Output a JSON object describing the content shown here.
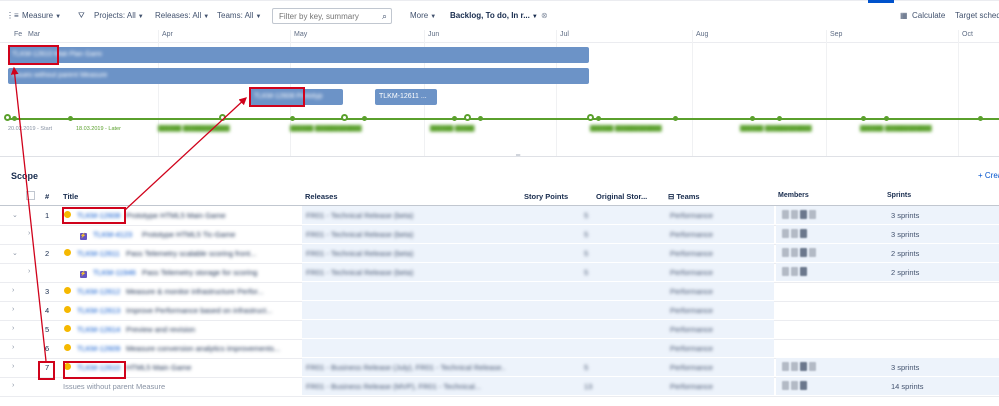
{
  "toolbar": {
    "measure": "Measure",
    "projects": "Projects: All",
    "releases": "Releases: All",
    "teams": "Teams: All",
    "search_placeholder": "Filter by key, summary",
    "more": "More",
    "view_filter": "Backlog, To do, In r...",
    "calculate": "Calculate",
    "target_schedule": "Target sched"
  },
  "months": [
    "Fe",
    "Mar",
    "Apr",
    "May",
    "Jun",
    "Jul",
    "Aug",
    "Sep",
    "Oct"
  ],
  "timeline": {
    "bar1_key": "TLKM-12610",
    "bar1_text": "TLKM-12610  Mali Plan Gami",
    "bar2_text": "Issues without parent Measure",
    "bar3_text": "TLKM-12608 Prototyp",
    "bar4_text": "TLKM-12611 ...",
    "release_start": "20.02.2019 - Start",
    "release_later": "18.03.2019 - Later"
  },
  "scope": {
    "title": "Scope",
    "create": "+ Crea"
  },
  "columns": {
    "num": "#",
    "title": "Title",
    "releases": "Releases",
    "story_points": "Story Points",
    "original": "Original Stor...",
    "teams": "Teams",
    "members": "Members",
    "sprints": "Sprints"
  },
  "rows": [
    {
      "num": "1",
      "key": "TLKM-12608",
      "summary": "Prototype HTML5 Main Game",
      "release": "FR01 - Technical Release (beta)",
      "points": "5",
      "team": "Performance",
      "sprints": "3 sprints"
    },
    {
      "num": "",
      "key": "TLKM-4123",
      "summary": "Prototype HTML5 Tic-Game",
      "release": "FR01 - Technical Release (beta)",
      "points": "5",
      "team": "Performance",
      "sprints": "3 sprints"
    },
    {
      "num": "2",
      "key": "TLKM-12611",
      "summary": "Pass Telemetry scalable scoring front...",
      "release": "FR01 - Technical Release (beta)",
      "points": "5",
      "team": "Performance",
      "sprints": "2 sprints"
    },
    {
      "num": "",
      "key": "TLKM-11946",
      "summary": "Pass Telemetry storage for scoring",
      "release": "FR01 - Technical Release (beta)",
      "points": "5",
      "team": "Performance",
      "sprints": "2 sprints"
    },
    {
      "num": "3",
      "key": "TLKM-12612",
      "summary": "Measure & monitor infrastructure Perfor...",
      "release": "",
      "points": "",
      "team": "Performance",
      "sprints": ""
    },
    {
      "num": "4",
      "key": "TLKM-12613",
      "summary": "Improve Performance based on infrastruct...",
      "release": "",
      "points": "",
      "team": "Performance",
      "sprints": ""
    },
    {
      "num": "5",
      "key": "TLKM-12614",
      "summary": "Preview and revision",
      "release": "",
      "points": "",
      "team": "Performance",
      "sprints": ""
    },
    {
      "num": "6",
      "key": "TLKM-12609",
      "summary": "Measure conversion analytics improvements...",
      "release": "",
      "points": "",
      "team": "Performance",
      "sprints": ""
    },
    {
      "num": "7",
      "key": "TLKM-12610",
      "summary": "HTML5 Main Game",
      "release": "FR01 - Business Release (July), FR01 - Technical Release...",
      "points": "5",
      "team": "Performance",
      "sprints": "3 sprints"
    },
    {
      "num": "",
      "key": "",
      "summary": "Issues without parent Measure",
      "release": "FR01 - Business Release (MVP), FR01 - Technical...",
      "points": "13",
      "team": "Performance",
      "sprints": "14 sprints"
    }
  ],
  "colors": {
    "accent": "#0052cc",
    "bar": "#6c93c7",
    "release_line": "#5aa02c",
    "annotation": "#d0021b"
  }
}
